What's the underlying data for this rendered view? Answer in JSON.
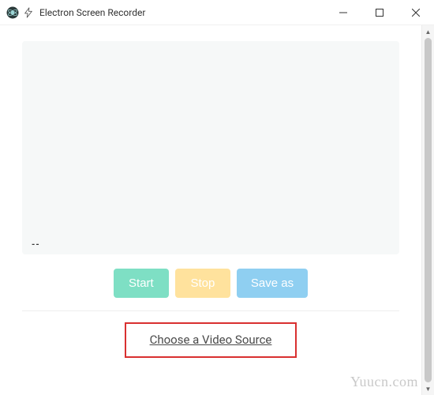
{
  "window": {
    "title": "Electron Screen Recorder"
  },
  "preview": {
    "marker": "--"
  },
  "buttons": {
    "start": "Start",
    "stop": "Stop",
    "save": "Save as"
  },
  "source_link": {
    "label": "Choose a Video Source"
  },
  "watermark": "Yuucn.com"
}
